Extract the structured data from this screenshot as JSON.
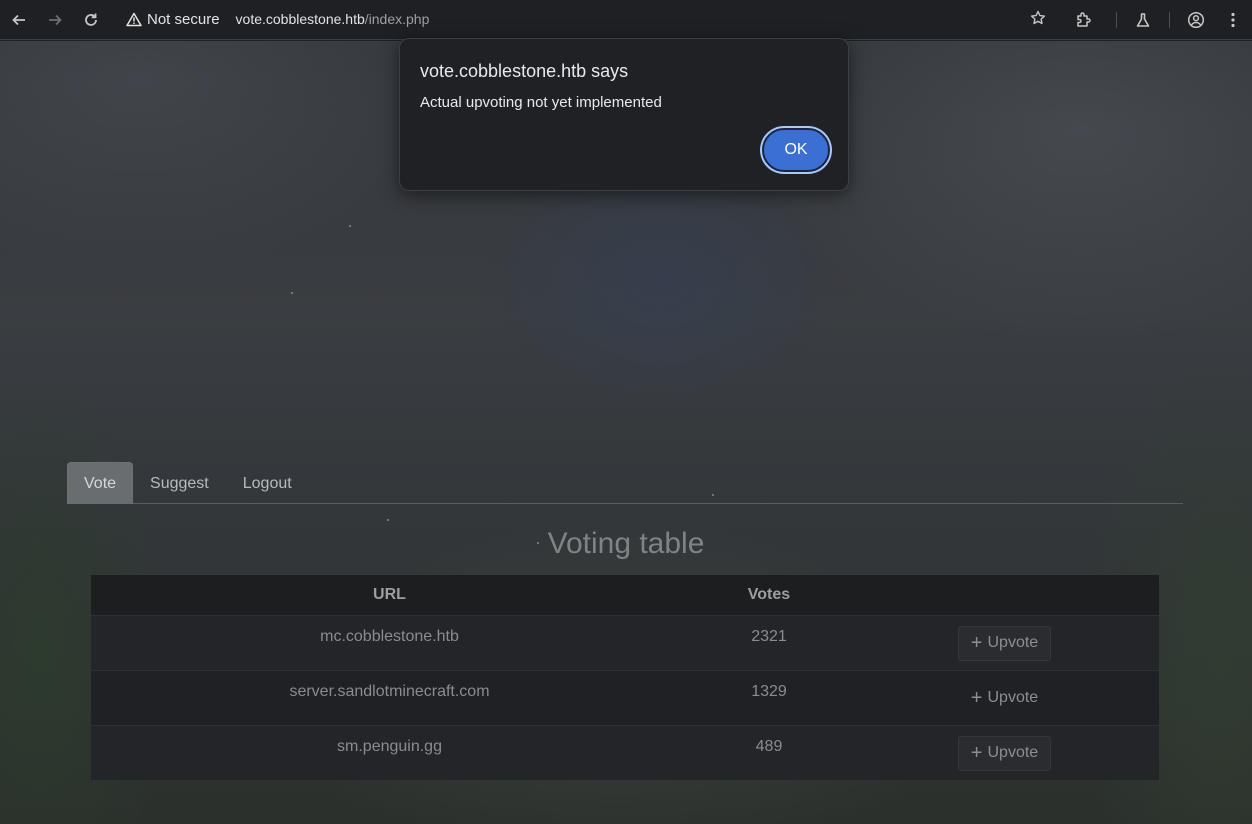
{
  "browser": {
    "security_label": "Not secure",
    "url_host": "vote.cobblestone.htb",
    "url_path": "/index.php"
  },
  "dialog": {
    "title": "vote.cobblestone.htb says",
    "message": "Actual upvoting not yet implemented",
    "ok_label": "OK"
  },
  "tabs": [
    {
      "label": "Vote",
      "active": true
    },
    {
      "label": "Suggest",
      "active": false
    },
    {
      "label": "Logout",
      "active": false
    }
  ],
  "table": {
    "title": "Voting table",
    "headers": [
      "URL",
      "Votes",
      ""
    ],
    "rows": [
      {
        "url": "mc.cobblestone.htb",
        "votes": "2321",
        "action": "Upvote"
      },
      {
        "url": "server.sandlotminecraft.com",
        "votes": "1329",
        "action": "Upvote"
      },
      {
        "url": "sm.penguin.gg",
        "votes": "489",
        "action": "Upvote"
      }
    ]
  },
  "colors": {
    "dialog_bg": "#202124",
    "ok_button": "#3b6fd4",
    "active_tab": "#6a6d70"
  }
}
